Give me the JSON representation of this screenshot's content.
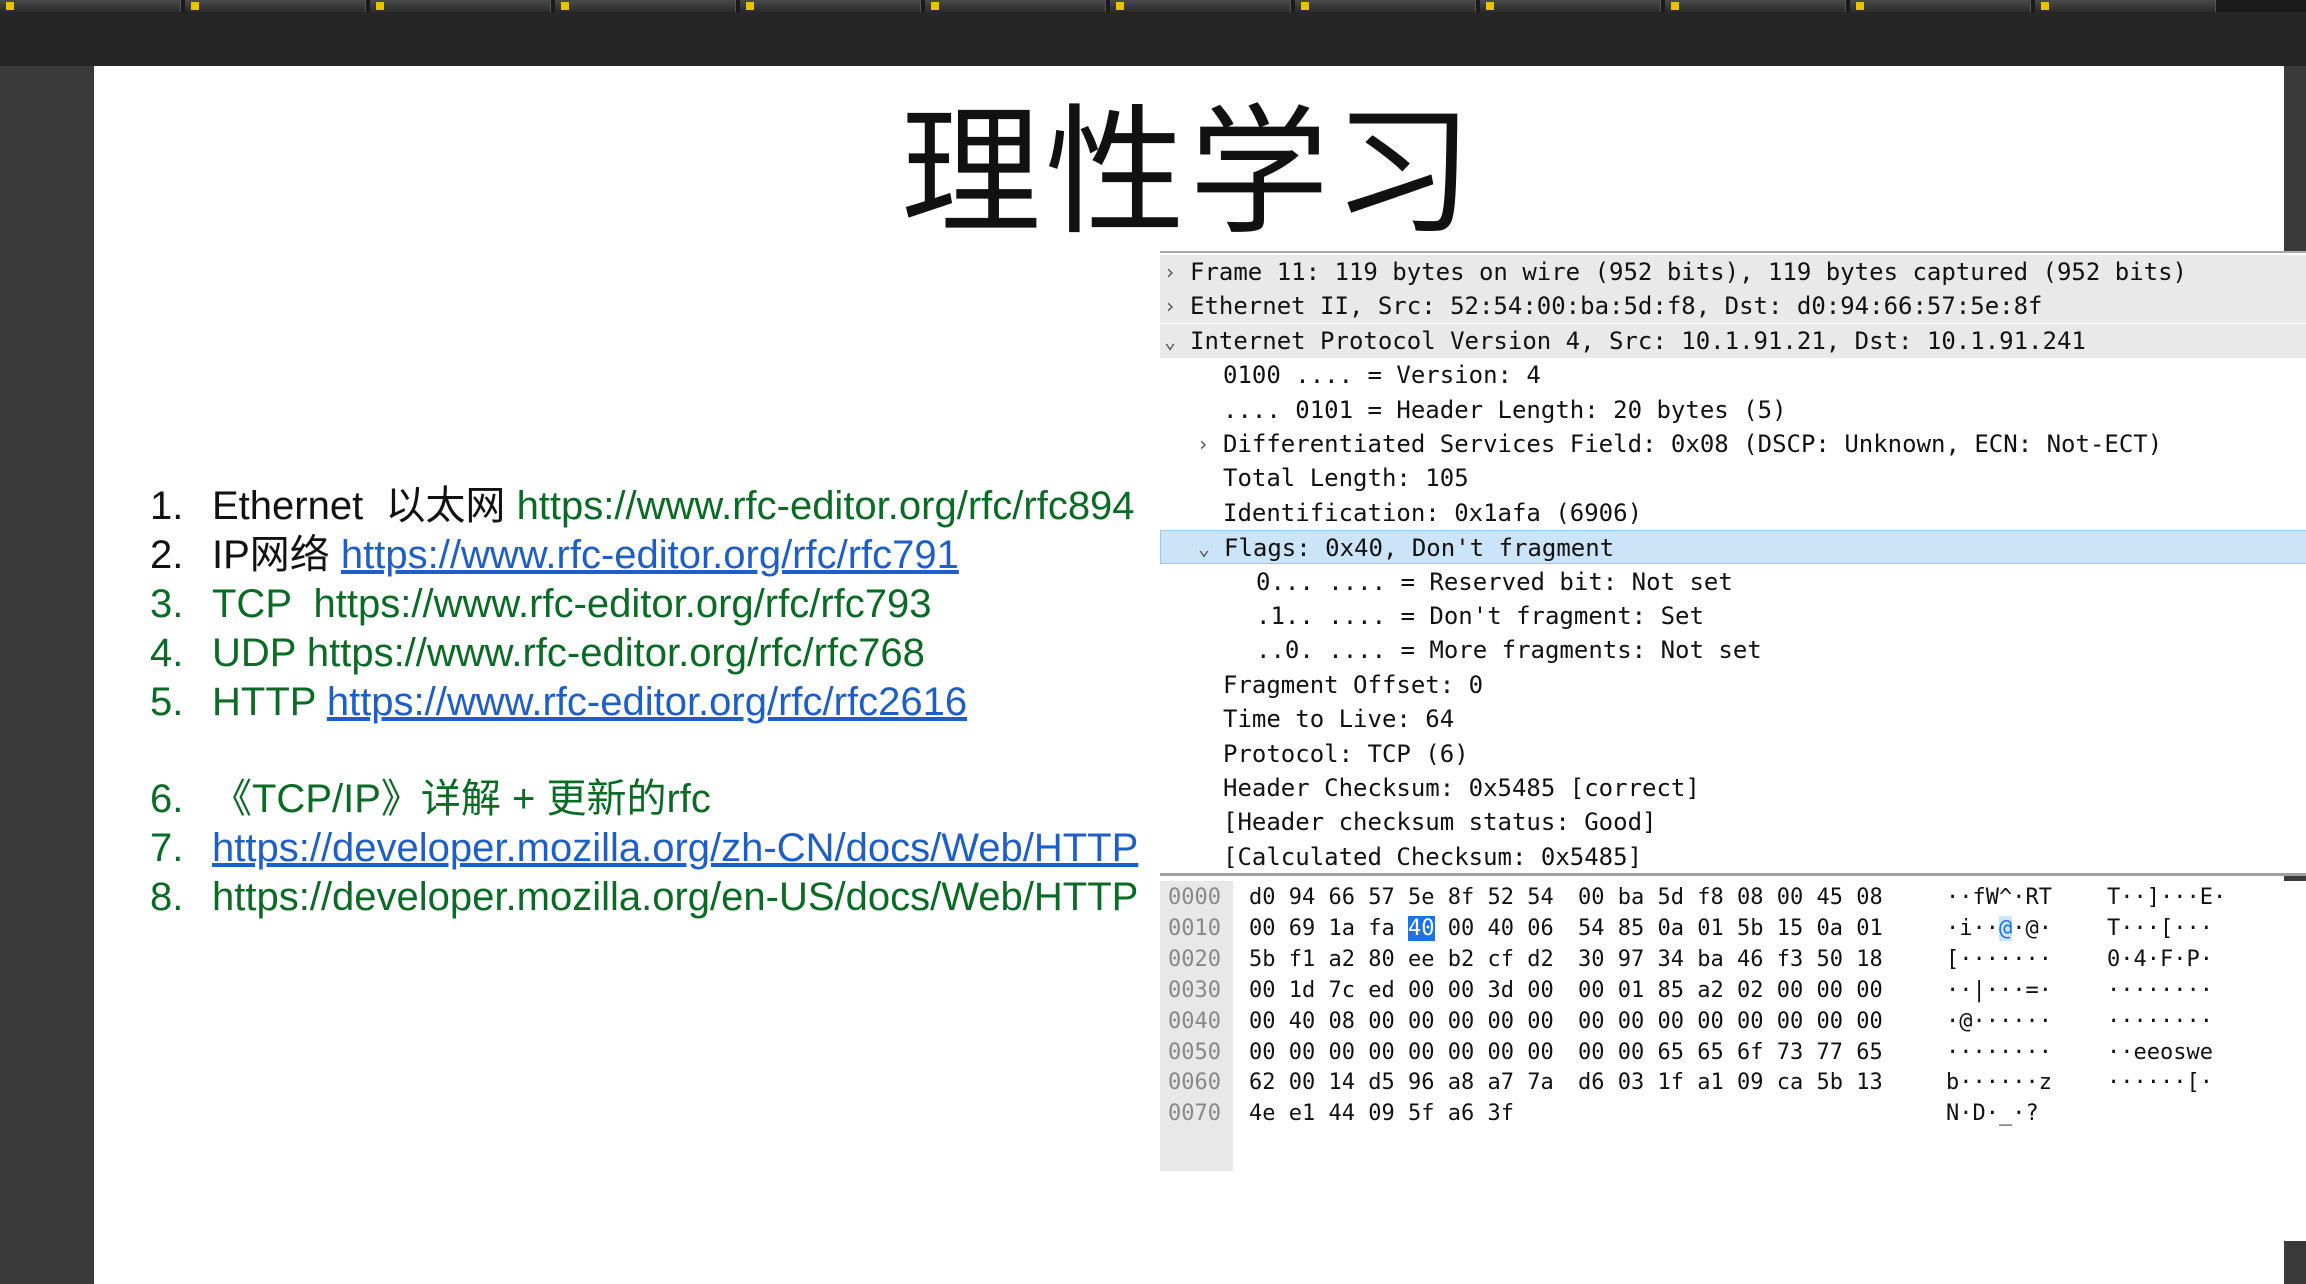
{
  "slide": {
    "title": "理性学习"
  },
  "references": [
    {
      "num": "1.",
      "label": "Ethernet  以太网 ",
      "url": "https://www.rfc-editor.org/rfc/rfc894",
      "num_color": "black",
      "label_color": "black",
      "url_style": "green"
    },
    {
      "num": "2.",
      "label": "IP网络 ",
      "url": "https://www.rfc-editor.org/rfc/rfc791",
      "num_color": "black",
      "label_color": "black",
      "url_style": "link"
    },
    {
      "num": "3.",
      "label": "TCP  ",
      "url": "https://www.rfc-editor.org/rfc/rfc793",
      "num_color": "green",
      "label_color": "green",
      "url_style": "green"
    },
    {
      "num": "4.",
      "label": "UDP ",
      "url": "https://www.rfc-editor.org/rfc/rfc768",
      "num_color": "green",
      "label_color": "green",
      "url_style": "green"
    },
    {
      "num": "5.",
      "label": "HTTP ",
      "url": "https://www.rfc-editor.org/rfc/rfc2616",
      "num_color": "green",
      "label_color": "green",
      "url_style": "link"
    },
    {
      "num": "6.",
      "label": "《TCP/IP》详解 + 更新的rfc",
      "url": "",
      "num_color": "green",
      "label_color": "green",
      "url_style": "green"
    },
    {
      "num": "7.",
      "label": "",
      "url": "https://developer.mozilla.org/zh-CN/docs/Web/HTTP",
      "num_color": "green",
      "label_color": "green",
      "url_style": "link"
    },
    {
      "num": "8.",
      "label": "",
      "url": "https://developer.mozilla.org/en-US/docs/Web/HTTP",
      "num_color": "green",
      "label_color": "green",
      "url_style": "green"
    }
  ],
  "packet_details": [
    {
      "text": "Frame 11: 119 bytes on wire (952 bits), 119 bytes captured (952 bits)",
      "arrow": "›",
      "indent": 0,
      "style": "gray"
    },
    {
      "text": "Ethernet II, Src: 52:54:00:ba:5d:f8, Dst: d0:94:66:57:5e:8f",
      "arrow": "›",
      "indent": 0,
      "style": "gray"
    },
    {
      "text": "Internet Protocol Version 4, Src: 10.1.91.21, Dst: 10.1.91.241",
      "arrow": "⌄",
      "indent": 0,
      "style": "gray"
    },
    {
      "text": "0100 .... = Version: 4",
      "arrow": "",
      "indent": 1,
      "style": ""
    },
    {
      "text": ".... 0101 = Header Length: 20 bytes (5)",
      "arrow": "",
      "indent": 1,
      "style": ""
    },
    {
      "text": "Differentiated Services Field: 0x08 (DSCP: Unknown, ECN: Not-ECT)",
      "arrow": "›",
      "indent": 1,
      "style": ""
    },
    {
      "text": "Total Length: 105",
      "arrow": "",
      "indent": 1,
      "style": ""
    },
    {
      "text": "Identification: 0x1afa (6906)",
      "arrow": "",
      "indent": 1,
      "style": ""
    },
    {
      "text": "Flags: 0x40, Don't fragment",
      "arrow": "⌄",
      "indent": 1,
      "style": "sel"
    },
    {
      "text": "0... .... = Reserved bit: Not set",
      "arrow": "",
      "indent": 2,
      "style": ""
    },
    {
      "text": ".1.. .... = Don't fragment: Set",
      "arrow": "",
      "indent": 2,
      "style": ""
    },
    {
      "text": "..0. .... = More fragments: Not set",
      "arrow": "",
      "indent": 2,
      "style": ""
    },
    {
      "text": "Fragment Offset: 0",
      "arrow": "",
      "indent": 1,
      "style": ""
    },
    {
      "text": "Time to Live: 64",
      "arrow": "",
      "indent": 1,
      "style": ""
    },
    {
      "text": "Protocol: TCP (6)",
      "arrow": "",
      "indent": 1,
      "style": ""
    },
    {
      "text": "Header Checksum: 0x5485 [correct]",
      "arrow": "",
      "indent": 1,
      "style": ""
    },
    {
      "text": "[Header checksum status: Good]",
      "arrow": "",
      "indent": 1,
      "style": ""
    },
    {
      "text": "[Calculated Checksum: 0x5485]",
      "arrow": "",
      "indent": 1,
      "style": ""
    }
  ],
  "hex_dump": [
    {
      "offset": "0000",
      "b1": [
        "d0",
        "94",
        "66",
        "57",
        "5e",
        "8f",
        "52",
        "54"
      ],
      "b2": [
        "00",
        "ba",
        "5d",
        "f8",
        "08",
        "00",
        "45",
        "08"
      ],
      "a1": "··fW^·RT",
      "a2": "T··]···E·"
    },
    {
      "offset": "0010",
      "b1": [
        "00",
        "69",
        "1a",
        "fa",
        "40",
        "00",
        "40",
        "06"
      ],
      "b2": [
        "54",
        "85",
        "0a",
        "01",
        "5b",
        "15",
        "0a",
        "01"
      ],
      "a1": "·i··@·@·",
      "a2": "T···[···"
    },
    {
      "offset": "0020",
      "b1": [
        "5b",
        "f1",
        "a2",
        "80",
        "ee",
        "b2",
        "cf",
        "d2"
      ],
      "b2": [
        "30",
        "97",
        "34",
        "ba",
        "46",
        "f3",
        "50",
        "18"
      ],
      "a1": "[·······",
      "a2": "0·4·F·P·"
    },
    {
      "offset": "0030",
      "b1": [
        "00",
        "1d",
        "7c",
        "ed",
        "00",
        "00",
        "3d",
        "00"
      ],
      "b2": [
        "00",
        "01",
        "85",
        "a2",
        "02",
        "00",
        "00",
        "00"
      ],
      "a1": "··|···=·",
      "a2": "········"
    },
    {
      "offset": "0040",
      "b1": [
        "00",
        "40",
        "08",
        "00",
        "00",
        "00",
        "00",
        "00"
      ],
      "b2": [
        "00",
        "00",
        "00",
        "00",
        "00",
        "00",
        "00",
        "00"
      ],
      "a1": "·@······",
      "a2": "········"
    },
    {
      "offset": "0050",
      "b1": [
        "00",
        "00",
        "00",
        "00",
        "00",
        "00",
        "00",
        "00"
      ],
      "b2": [
        "00",
        "00",
        "65",
        "65",
        "6f",
        "73",
        "77",
        "65"
      ],
      "a1": "········",
      "a2": "··eeoswe"
    },
    {
      "offset": "0060",
      "b1": [
        "62",
        "00",
        "14",
        "d5",
        "96",
        "a8",
        "a7",
        "7a"
      ],
      "b2": [
        "d6",
        "03",
        "1f",
        "a1",
        "09",
        "ca",
        "5b",
        "13"
      ],
      "a1": "b······z",
      "a2": "······[·"
    },
    {
      "offset": "0070",
      "b1": [
        "4e",
        "e1",
        "44",
        "09",
        "5f",
        "a6",
        "3f"
      ],
      "b2": [],
      "a1": "N·D·_·?",
      "a2": ""
    }
  ],
  "hex_highlight": {
    "row": 1,
    "byte": 4,
    "ascii_index": 4
  },
  "colors": {
    "green": "#0a6b24",
    "link": "#1e5ec8",
    "selection": "#cce4f7",
    "hex_highlight": "#1a73e8"
  }
}
